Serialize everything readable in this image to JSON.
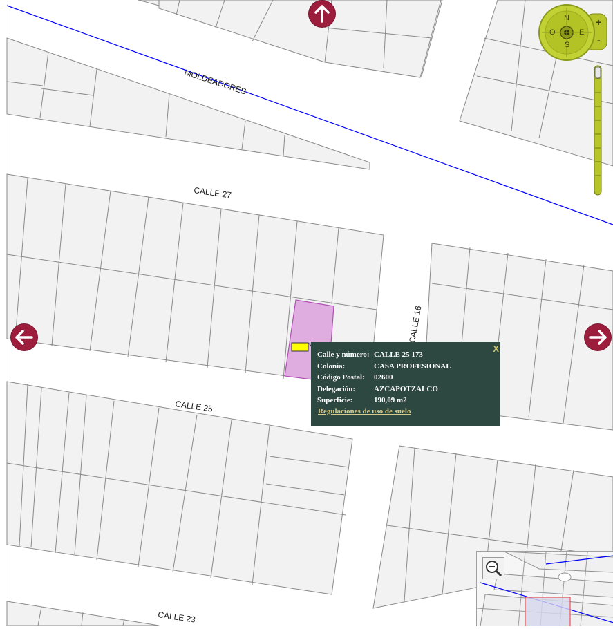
{
  "streets": {
    "moldeadores": "MOLDEADORES",
    "calle_27": "CALLE 27",
    "calle_25": "CALLE 25",
    "calle_23": "CALLE 23",
    "calle_16": "CALLE 16"
  },
  "compass": {
    "north": "N",
    "south": "S",
    "east": "E",
    "west": "O",
    "zoom_in": "+",
    "zoom_out": "-"
  },
  "popup": {
    "close_label": "X",
    "rows": [
      {
        "label": "Calle y número:",
        "value": "CALLE 25 173"
      },
      {
        "label": "Colonia:",
        "value": "CASA PROFESIONAL"
      },
      {
        "label": "Código Postal:",
        "value": "02600"
      },
      {
        "label": "Delegación:",
        "value": "AZCAPOTZALCO"
      },
      {
        "label": "Superficie:",
        "value": "190,09 m2"
      }
    ],
    "link_label": "Regulaciones de uso de suelo"
  },
  "colors": {
    "parcel_highlight": "#e0ade0",
    "parcel_highlight_border": "#b14fb5",
    "arrow": "#9d1d3c",
    "popup_bg": "#2c4840",
    "popup_link": "#d7c98b",
    "street_line": "#0000ff",
    "block_fill": "#f2f2f2"
  }
}
